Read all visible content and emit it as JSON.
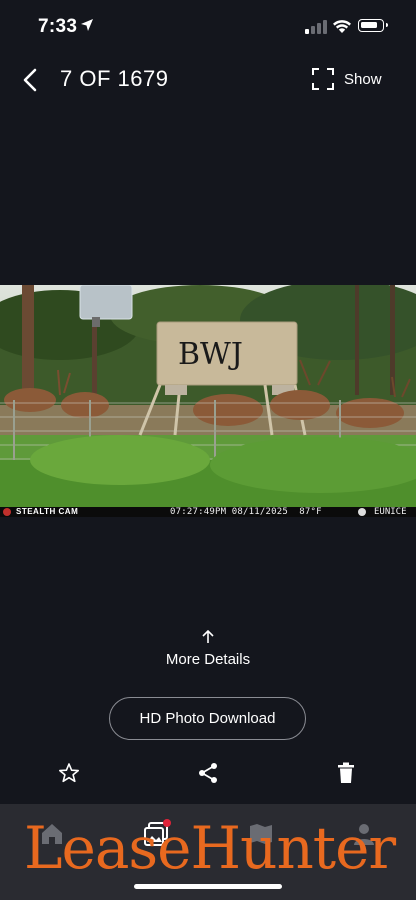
{
  "status": {
    "time": "7:33",
    "battery_level": 0.7,
    "icons": [
      "location-arrow-icon",
      "cellular-signal-icon",
      "wifi-icon",
      "battery-icon"
    ]
  },
  "header": {
    "back_icon": "chevron-left-icon",
    "counter": "7 OF 1679",
    "show_label": "Show",
    "show_icon": "fullscreen-icon"
  },
  "photo": {
    "brand": "STEALTH CAM",
    "timestamp": "07:27:49PM 08/11/2025",
    "temperature": "87°F",
    "location": "EUNICE",
    "feeder_logo": "BWJ"
  },
  "details": {
    "label": "More Details",
    "icon": "arrow-up-icon"
  },
  "download": {
    "label": "HD Photo Download"
  },
  "actions": {
    "icons": [
      "star-icon",
      "share-icon",
      "trash-icon"
    ]
  },
  "tabs": {
    "icons": [
      "home-icon",
      "gallery-icon",
      "map-icon",
      "profile-icon"
    ],
    "gallery_badge": true
  },
  "watermark": {
    "text": "LeaseHunter"
  },
  "colors": {
    "background": "#14161d",
    "tabbar": "#2a2b31",
    "watermark": "#e8691f",
    "badge": "#e0243a"
  }
}
